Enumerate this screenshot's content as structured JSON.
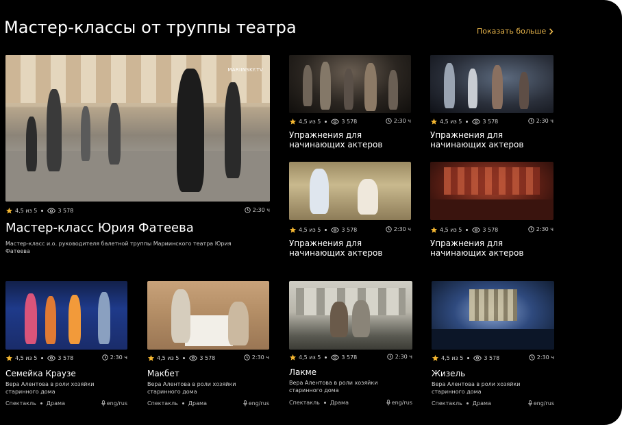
{
  "header": {
    "title": "Мастер-классы от труппы театра",
    "show_more": "Показать больше"
  },
  "cards": {
    "featured": {
      "rating": "4,5 из 5",
      "views": "3 578",
      "duration": "2:30 ч",
      "title": "Мастер-класс Юрия Фатеева",
      "description": "Мастер-класс и.о. руководителя балетной труппы Мариинского театра Юрия Фатеева",
      "watermark": "MARIINSKY.TV"
    },
    "small": [
      {
        "rating": "4,5 из 5",
        "views": "3 578",
        "duration": "2:30 ч",
        "title": "Упражнения для начинающих актеров"
      },
      {
        "rating": "4,5 из 5",
        "views": "3 578",
        "duration": "2:30 ч",
        "title": "Упражнения для начинающих актеров"
      },
      {
        "rating": "4,5 из 5",
        "views": "3 578",
        "duration": "2:30 ч",
        "title": "Упражнения для начинающих актеров"
      },
      {
        "rating": "4,5 из 5",
        "views": "3 578",
        "duration": "2:30 ч",
        "title": "Упражнения для начинающих актеров"
      }
    ],
    "bottom": [
      {
        "rating": "4,5 из 5",
        "views": "3 578",
        "duration": "2:30 ч",
        "title": "Семейка Краузе",
        "description": "Вера Алентова в роли хозяйки старинного дома",
        "type": "Спектакль",
        "genre": "Драма",
        "lang": "eng/rus"
      },
      {
        "rating": "4,5 из 5",
        "views": "3 578",
        "duration": "2:30 ч",
        "title": "Макбет",
        "description": "Вера Алентова в роли хозяйки старинного дома",
        "type": "Спектакль",
        "genre": "Драма",
        "lang": "eng/rus"
      },
      {
        "rating": "4,5 из 5",
        "views": "3 578",
        "duration": "2:30 ч",
        "title": "Лакме",
        "description": "Вера Алентова в роли хозяйки старинного дома",
        "type": "Спектакль",
        "genre": "Драма",
        "lang": "eng/rus"
      },
      {
        "rating": "4,5 из 5",
        "views": "3 578",
        "duration": "2:30 ч",
        "title": "Жизель",
        "description": "Вера Алентова в роли хозяйки старинного дома",
        "type": "Спектакль",
        "genre": "Драма",
        "lang": "eng/rus"
      }
    ]
  },
  "colors": {
    "background": "#000000",
    "accent": "#e8b54a",
    "star": "#f5b731",
    "text_muted": "#cfcfcf"
  },
  "icons": [
    "star-icon",
    "eye-icon",
    "clock-icon",
    "microphone-icon",
    "chevron-right-icon"
  ]
}
